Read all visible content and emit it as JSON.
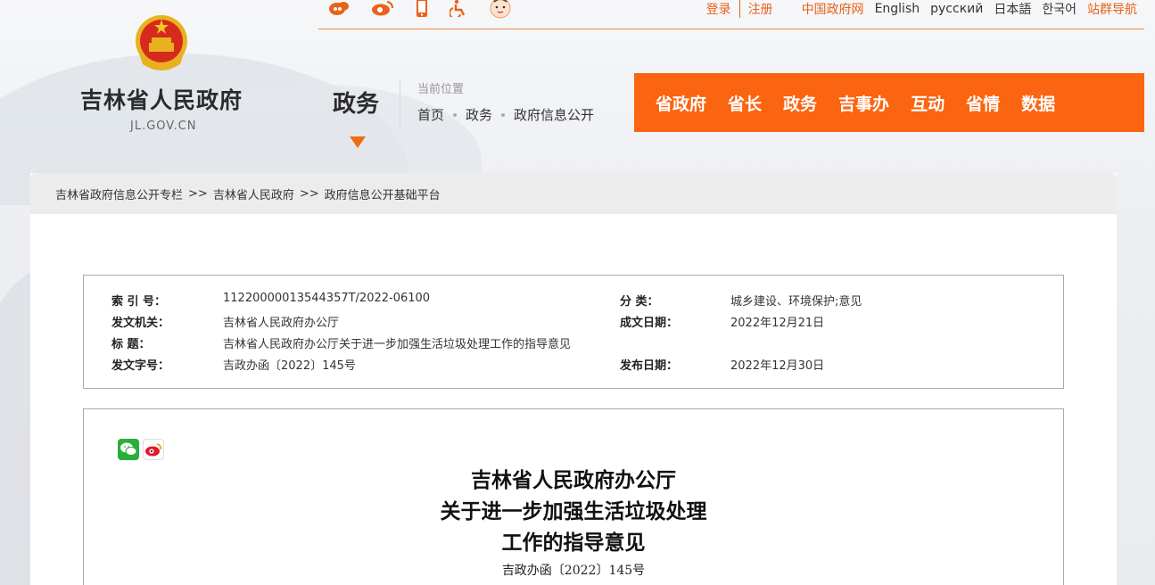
{
  "site": {
    "title": "吉林省人民政府",
    "domain": "JL.GOV.CN",
    "section": "政务"
  },
  "social_icons": [
    "weibo-icon",
    "weibo-alt-icon",
    "mobile-icon",
    "accessibility-icon",
    "kids-icon"
  ],
  "toplinks": {
    "login": "登录",
    "register": "注册",
    "gov": "中国政府网",
    "english": "English",
    "russian": "русский",
    "japanese": "日本語",
    "korean": "한국어",
    "sitemap": "站群导航"
  },
  "location": {
    "label": "当前位置",
    "crumbs": [
      "首页",
      "政务",
      "政府信息公开"
    ]
  },
  "mainnav": [
    "省政府",
    "省长",
    "政务",
    "吉事办",
    "互动",
    "省情",
    "数据"
  ],
  "breadcrumb": {
    "items": [
      "吉林省政府信息公开专栏",
      "吉林省人民政府",
      "政府信息公开基础平台"
    ],
    "separator": ">>"
  },
  "meta": {
    "index_label": "索 引 号：",
    "index_value": "11220000013544357T/2022-06100",
    "category_label": "分    类：",
    "category_value": "城乡建设、环境保护;意见",
    "issuer_label": "发文机关：",
    "issuer_value": "吉林省人民政府办公厅",
    "date_made_label": "成文日期：",
    "date_made_value": "2022年12月21日",
    "title_label": "标       题：",
    "title_value": "吉林省人民政府办公厅关于进一步加强生活垃圾处理工作的指导意见",
    "docno_label": "发文字号：",
    "docno_value": "吉政办函〔2022〕145号",
    "pub_date_label": "发布日期：",
    "pub_date_value": "2022年12月30日"
  },
  "document": {
    "title_line1": "吉林省人民政府办公厅",
    "title_line2": "关于进一步加强生活垃圾处理",
    "title_line3": "工作的指导意见",
    "number": "吉政办函〔2022〕145号"
  },
  "share_icons": [
    "wechat-icon",
    "weibo-share-icon"
  ],
  "colors": {
    "accent": "#fb6410",
    "link": "#e8621a"
  }
}
